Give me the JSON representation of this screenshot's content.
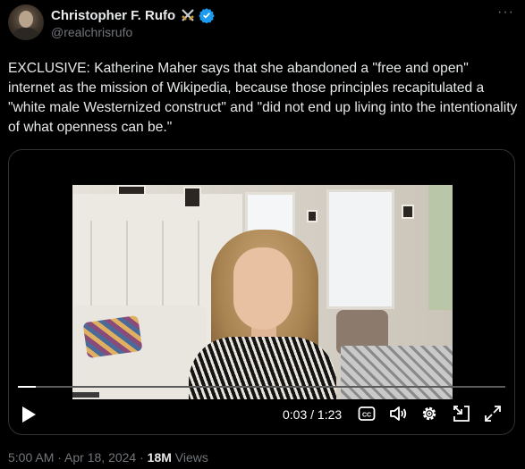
{
  "author": {
    "display_name": "Christopher F. Rufo",
    "handle": "@realchrisrufo",
    "badge": "verified-icon",
    "emoji": "crossed-swords-icon",
    "more_label": "···"
  },
  "tweet": {
    "text": "EXCLUSIVE: Katherine Maher says that she abandoned a \"free and open\" internet as the mission of Wikipedia, because those principles recapitulated a \"white male Westernized construct\" and \"did not end up living into the intentionality of what openness can be.\""
  },
  "video": {
    "current_time": "0:03",
    "separator": " / ",
    "duration": "1:23",
    "progress_fraction": 0.036,
    "controls": [
      "play-icon",
      "captions-icon",
      "volume-icon",
      "settings-icon",
      "dock-icon",
      "fullscreen-icon"
    ]
  },
  "meta": {
    "time": "5:00 AM",
    "dot1": " · ",
    "date": "Apr 18, 2024",
    "dot2": " · ",
    "views_count": "18M",
    "views_label": " Views"
  },
  "colors": {
    "background": "#000000",
    "text_primary": "#e7e9ea",
    "text_secondary": "#71767b",
    "verified_blue": "#1d9bf0",
    "border": "#2f3336"
  }
}
